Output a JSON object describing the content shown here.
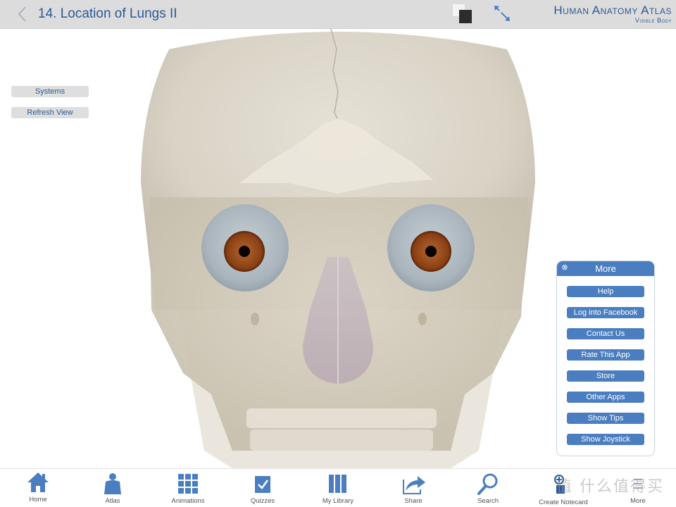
{
  "header": {
    "back_icon": "chevron-left-icon",
    "title": "14. Location of Lungs II",
    "background_toggle_icon": "background-color-toggle-icon",
    "fullscreen_icon": "expand-arrows-icon",
    "brand_main": "Human Anatomy Atlas",
    "brand_sub": "Visible Body"
  },
  "side_controls": {
    "systems_label": "Systems",
    "refresh_label": "Refresh View"
  },
  "viewer": {
    "model": "skull-anterior-view",
    "description": "3D skull with eyeballs and nasal cartilage, anterior view"
  },
  "more_menu": {
    "title": "More",
    "close_icon": "close-circle-icon",
    "items": [
      {
        "label": "Help"
      },
      {
        "label": "Log into Facebook"
      },
      {
        "label": "Contact Us"
      },
      {
        "label": "Rate This App"
      },
      {
        "label": "Store"
      },
      {
        "label": "Other Apps"
      },
      {
        "label": "Show Tips"
      },
      {
        "label": "Show Joystick"
      }
    ]
  },
  "tabbar": {
    "items": [
      {
        "label": "Home",
        "icon": "home-icon"
      },
      {
        "label": "Atlas",
        "icon": "human-figure-icon"
      },
      {
        "label": "Animations",
        "icon": "grid-icon"
      },
      {
        "label": "Quizzes",
        "icon": "checkbox-icon"
      },
      {
        "label": "My Library",
        "icon": "library-icon"
      },
      {
        "label": "Share",
        "icon": "share-arrow-icon"
      },
      {
        "label": "Search",
        "icon": "magnifier-icon"
      },
      {
        "label": "Create Notecard",
        "icon": "notecard-icon"
      },
      {
        "label": "More",
        "icon": "more-icon"
      }
    ]
  },
  "watermark": "值 什么值得买",
  "colors": {
    "accent": "#4a7ec0",
    "title_text": "#2c5a94",
    "topbar_bg": "#dcdcdc"
  }
}
